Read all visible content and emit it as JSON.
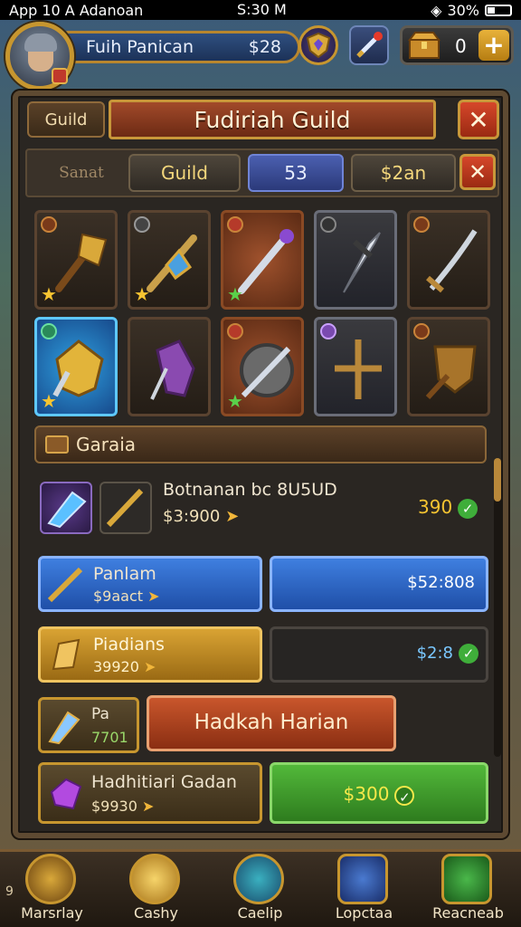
{
  "status_bar": {
    "left": "App 10 A Adanoan",
    "center": "S:30 M",
    "battery": "30%"
  },
  "player": {
    "name": "Fuih Panican",
    "currency": "$28"
  },
  "resources": {
    "chest_count": "0"
  },
  "panel": {
    "guild_tab": "Guild",
    "title": "Fudiriah Guild",
    "close_symbol": "✕"
  },
  "tabs": {
    "tab_a": "Sanat",
    "tab_b": "Guild",
    "tab_c": "53",
    "tab_d": "$2an"
  },
  "grid_items": [
    {
      "name": "golden-horn",
      "rarity": "bronze"
    },
    {
      "name": "gem-dagger",
      "rarity": "bronze"
    },
    {
      "name": "magic-staff",
      "rarity": "rare"
    },
    {
      "name": "steel-dagger",
      "rarity": "common"
    },
    {
      "name": "curved-blade",
      "rarity": "bronze"
    },
    {
      "name": "golden-armor",
      "rarity": "epic"
    },
    {
      "name": "purple-gauntlet",
      "rarity": "common"
    },
    {
      "name": "round-shield",
      "rarity": "rare"
    },
    {
      "name": "crossed-swords",
      "rarity": "common"
    },
    {
      "name": "wooden-shield",
      "rarity": "bronze"
    }
  ],
  "section": {
    "title": "Garaia"
  },
  "rows": {
    "r1": {
      "title": "Botnanan bc 8U5UD",
      "price": "$3:900",
      "right_value": "390"
    },
    "r2": {
      "title": "Panlam",
      "price": "$9aact",
      "button": "$52:808"
    },
    "r3": {
      "title": "Piadians",
      "price": "39920",
      "right_value": "$2:8"
    },
    "r4": {
      "title": "Pa",
      "price": "7701",
      "button": "Hadkah Harian"
    },
    "r5": {
      "title": "Hadhitiari Gadan",
      "price": "$9930",
      "button": "$300"
    }
  },
  "nav": [
    {
      "label": "Marsrlay",
      "num": "9"
    },
    {
      "label": "Cashy"
    },
    {
      "label": "Caelip"
    },
    {
      "label": "Lopctaa"
    },
    {
      "label": "Reacneab"
    }
  ],
  "colors": {
    "accent_gold": "#c7962f",
    "panel_bg": "#2a2622",
    "button_blue": "#3f7fe0",
    "button_green": "#52b83a",
    "title_red": "#a24a2a"
  }
}
